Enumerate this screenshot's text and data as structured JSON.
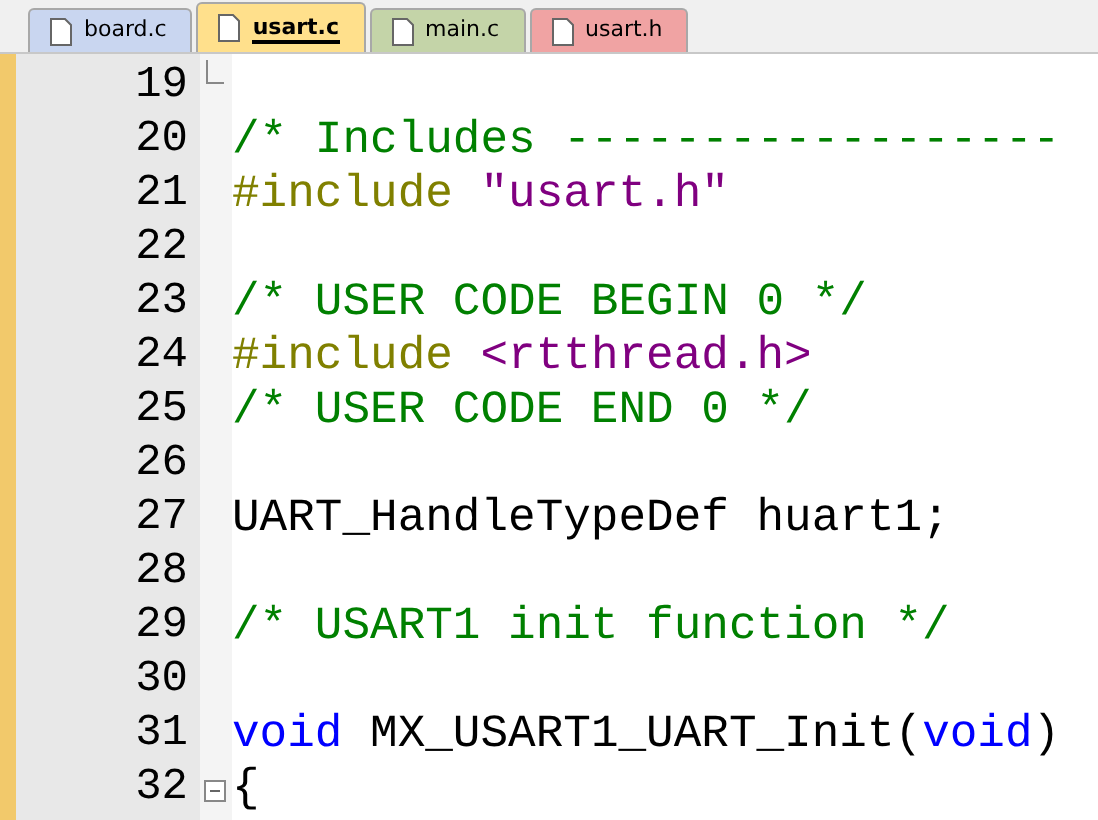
{
  "tabs": [
    {
      "label": "board.c",
      "selected": false,
      "color": "#c9d6f0"
    },
    {
      "label": "usart.c",
      "selected": true,
      "color": "#ffe08c"
    },
    {
      "label": "main.c",
      "selected": false,
      "color": "#c4d4a8"
    },
    {
      "label": "usart.h",
      "selected": false,
      "color": "#f0a3a3"
    }
  ],
  "lines": [
    {
      "number": "19",
      "fold_end": true,
      "collapsible": false
    },
    {
      "number": "20",
      "fold_end": false,
      "collapsible": false,
      "tokens": [
        {
          "kind": "comment",
          "text": "/* Includes ------------------"
        }
      ]
    },
    {
      "number": "21",
      "fold_end": false,
      "collapsible": false,
      "tokens": [
        {
          "kind": "preprocessor",
          "text": "#include "
        },
        {
          "kind": "string",
          "text": "\"usart.h\""
        }
      ]
    },
    {
      "number": "22",
      "fold_end": false,
      "collapsible": false
    },
    {
      "number": "23",
      "fold_end": false,
      "collapsible": false,
      "tokens": [
        {
          "kind": "comment",
          "text": "/* USER CODE BEGIN 0 */"
        }
      ]
    },
    {
      "number": "24",
      "fold_end": false,
      "collapsible": false,
      "tokens": [
        {
          "kind": "preprocessor",
          "text": "#include "
        },
        {
          "kind": "string",
          "text": "<rtthread.h>"
        }
      ]
    },
    {
      "number": "25",
      "fold_end": false,
      "collapsible": false,
      "tokens": [
        {
          "kind": "comment",
          "text": "/* USER CODE END 0 */"
        }
      ]
    },
    {
      "number": "26",
      "fold_end": false,
      "collapsible": false
    },
    {
      "number": "27",
      "fold_end": false,
      "collapsible": false,
      "tokens": [
        {
          "kind": "plain",
          "text": "UART_HandleTypeDef huart1;"
        }
      ]
    },
    {
      "number": "28",
      "fold_end": false,
      "collapsible": false
    },
    {
      "number": "29",
      "fold_end": false,
      "collapsible": false,
      "tokens": [
        {
          "kind": "comment",
          "text": "/* USART1 init function */"
        }
      ]
    },
    {
      "number": "30",
      "fold_end": false,
      "collapsible": false
    },
    {
      "number": "31",
      "fold_end": false,
      "collapsible": false,
      "tokens": [
        {
          "kind": "keyword",
          "text": "void"
        },
        {
          "kind": "plain",
          "text": " MX_USART1_UART_Init("
        },
        {
          "kind": "keyword",
          "text": "void"
        },
        {
          "kind": "plain",
          "text": ")"
        }
      ]
    },
    {
      "number": "32",
      "fold_end": false,
      "collapsible": true,
      "tokens": [
        {
          "kind": "plain",
          "text": "{"
        }
      ]
    }
  ]
}
